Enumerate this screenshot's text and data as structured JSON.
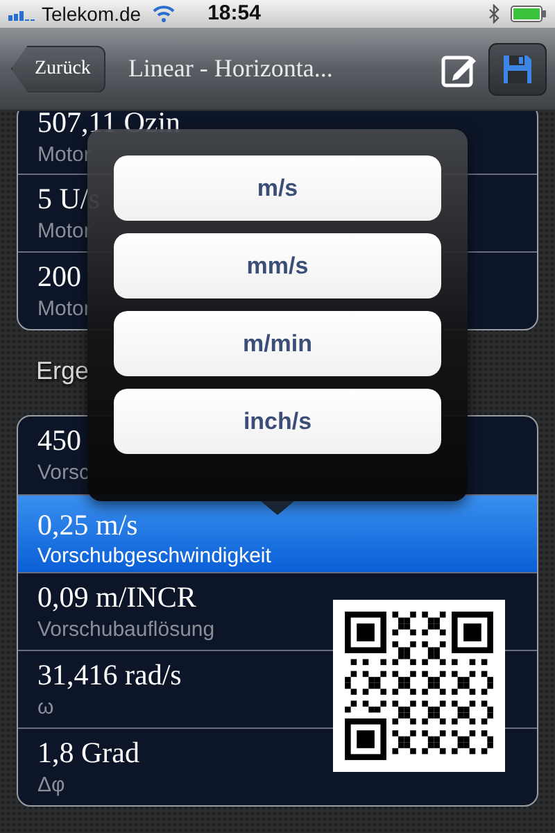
{
  "status_bar": {
    "carrier": "Telekom.de",
    "time": "18:54"
  },
  "nav_bar": {
    "back_button": "Zurück",
    "title": "Linear - Horizonta..."
  },
  "groups": [
    {
      "rows": [
        {
          "value": "507,11 Ozin",
          "label": "Motor",
          "selected": false
        },
        {
          "value": "5 U/s",
          "label": "Motor",
          "selected": false
        },
        {
          "value": "200",
          "label": "Motor",
          "selected": false
        }
      ]
    },
    {
      "header": "Erge",
      "rows": [
        {
          "value": "450",
          "label": "Vorsc",
          "selected": false
        },
        {
          "value": "0,25 m/s",
          "label": "Vorschubgeschwindigkeit",
          "selected": true
        },
        {
          "value": "0,09 m/INCR",
          "label": "Vorschubauflösung",
          "selected": false
        },
        {
          "value": "31,416 rad/s",
          "label": "ω",
          "selected": false
        },
        {
          "value": "1,8 Grad",
          "label": "Δφ",
          "selected": false
        }
      ]
    }
  ],
  "popover": {
    "options": [
      {
        "label": "m/s"
      },
      {
        "label": "mm/s"
      },
      {
        "label": "m/min"
      },
      {
        "label": "inch/s"
      }
    ]
  }
}
